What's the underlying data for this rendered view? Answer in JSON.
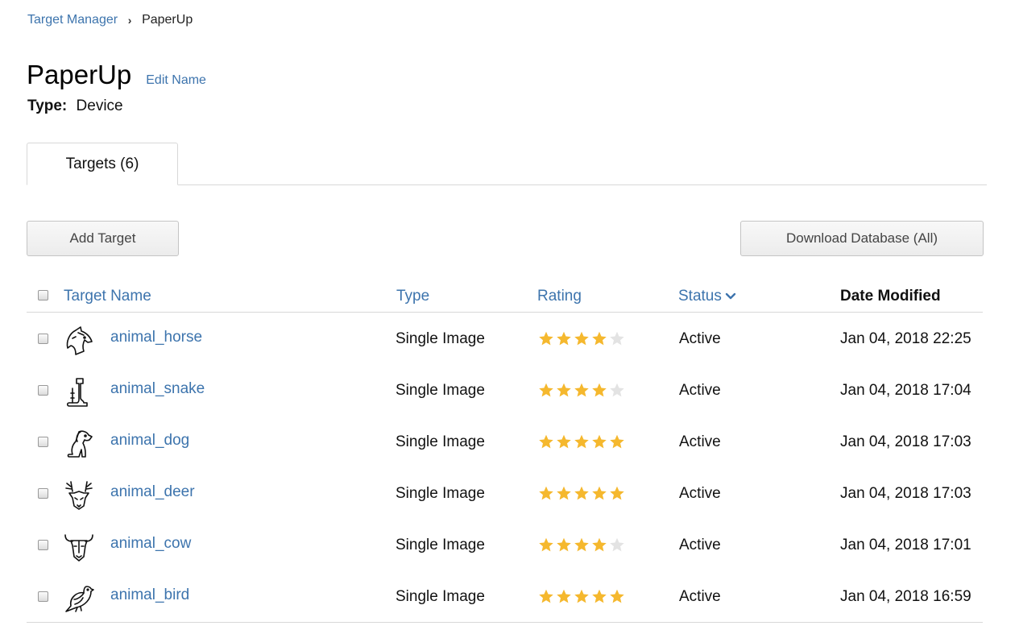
{
  "breadcrumb": {
    "parent": "Target Manager",
    "separator": "›",
    "current": "PaperUp"
  },
  "header": {
    "title": "PaperUp",
    "edit_label": "Edit Name",
    "type_label": "Type:",
    "type_value": "Device"
  },
  "tabs": [
    {
      "label": "Targets (6)",
      "active": true
    }
  ],
  "toolbar": {
    "add_label": "Add Target",
    "download_label": "Download Database (All)"
  },
  "table": {
    "columns": {
      "name": "Target Name",
      "type": "Type",
      "rating": "Rating",
      "status": "Status",
      "date": "Date Modified"
    },
    "rows": [
      {
        "icon": "horse-icon",
        "name": "animal_horse",
        "type": "Single Image",
        "rating": 4,
        "status": "Active",
        "date": "Jan 04, 2018 22:25"
      },
      {
        "icon": "snake-icon",
        "name": "animal_snake",
        "type": "Single Image",
        "rating": 4,
        "status": "Active",
        "date": "Jan 04, 2018 17:04"
      },
      {
        "icon": "dog-icon",
        "name": "animal_dog",
        "type": "Single Image",
        "rating": 5,
        "status": "Active",
        "date": "Jan 04, 2018 17:03"
      },
      {
        "icon": "deer-icon",
        "name": "animal_deer",
        "type": "Single Image",
        "rating": 5,
        "status": "Active",
        "date": "Jan 04, 2018 17:03"
      },
      {
        "icon": "cow-icon",
        "name": "animal_cow",
        "type": "Single Image",
        "rating": 4,
        "status": "Active",
        "date": "Jan 04, 2018 17:01"
      },
      {
        "icon": "bird-icon",
        "name": "animal_bird",
        "type": "Single Image",
        "rating": 5,
        "status": "Active",
        "date": "Jan 04, 2018 16:59"
      }
    ],
    "max_rating": 5
  },
  "colors": {
    "link": "#3d74ad",
    "star_on": "#f5b82e",
    "star_off": "#e3e3e3"
  }
}
